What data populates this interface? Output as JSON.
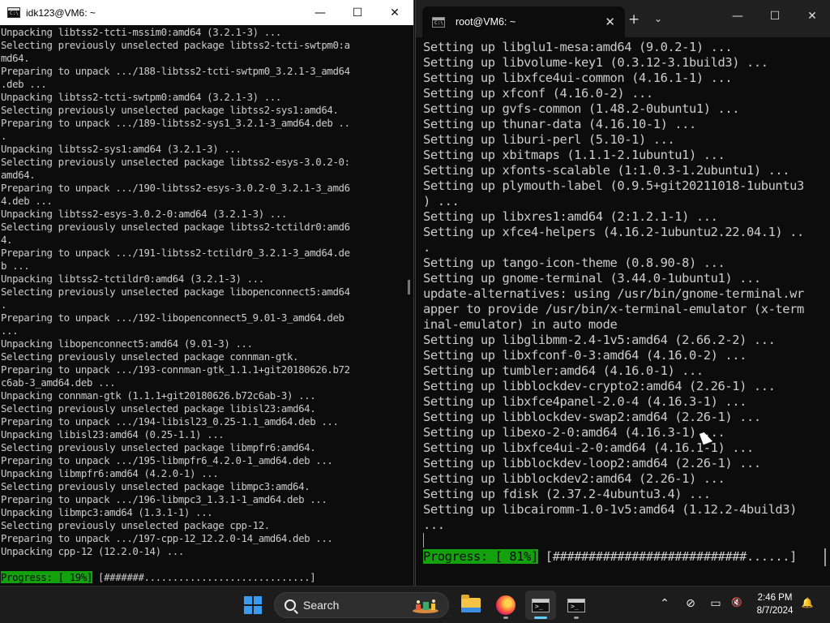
{
  "left_window": {
    "title": "idk123@VM6: ~",
    "app_icon_glyph": "C:\\",
    "controls": {
      "minimize": "—",
      "maximize": "☐",
      "close": "✕"
    },
    "lines": [
      "Unpacking libtss2-tcti-mssim0:amd64 (3.2.1-3) ...",
      "Selecting previously unselected package libtss2-tcti-swtpm0:a",
      "md64.",
      "Preparing to unpack .../188-libtss2-tcti-swtpm0_3.2.1-3_amd64",
      ".deb ...",
      "Unpacking libtss2-tcti-swtpm0:amd64 (3.2.1-3) ...",
      "Selecting previously unselected package libtss2-sys1:amd64.",
      "Preparing to unpack .../189-libtss2-sys1_3.2.1-3_amd64.deb ..",
      ".",
      "Unpacking libtss2-sys1:amd64 (3.2.1-3) ...",
      "Selecting previously unselected package libtss2-esys-3.0.2-0:",
      "amd64.",
      "Preparing to unpack .../190-libtss2-esys-3.0.2-0_3.2.1-3_amd6",
      "4.deb ...",
      "Unpacking libtss2-esys-3.0.2-0:amd64 (3.2.1-3) ...",
      "Selecting previously unselected package libtss2-tctildr0:amd6",
      "4.",
      "Preparing to unpack .../191-libtss2-tctildr0_3.2.1-3_amd64.de",
      "b ...",
      "Unpacking libtss2-tctildr0:amd64 (3.2.1-3) ...",
      "Selecting previously unselected package libopenconnect5:amd64",
      ".",
      "Preparing to unpack .../192-libopenconnect5_9.01-3_amd64.deb",
      "...",
      "Unpacking libopenconnect5:amd64 (9.01-3) ...",
      "Selecting previously unselected package connman-gtk.",
      "Preparing to unpack .../193-connman-gtk_1.1.1+git20180626.b72",
      "c6ab-3_amd64.deb ...",
      "Unpacking connman-gtk (1.1.1+git20180626.b72c6ab-3) ...",
      "Selecting previously unselected package libisl23:amd64.",
      "Preparing to unpack .../194-libisl23_0.25-1.1_amd64.deb ...",
      "Unpacking libisl23:amd64 (0.25-1.1) ...",
      "Selecting previously unselected package libmpfr6:amd64.",
      "Preparing to unpack .../195-libmpfr6_4.2.0-1_amd64.deb ...",
      "Unpacking libmpfr6:amd64 (4.2.0-1) ...",
      "Selecting previously unselected package libmpc3:amd64.",
      "Preparing to unpack .../196-libmpc3_1.3.1-1_amd64.deb ...",
      "Unpacking libmpc3:amd64 (1.3.1-1) ...",
      "Selecting previously unselected package cpp-12.",
      "Preparing to unpack .../197-cpp-12_12.2.0-14_amd64.deb ...",
      "Unpacking cpp-12 (12.2.0-14) ..."
    ],
    "progress_label": "Progress: [ 19%]",
    "progress_bar": " [#######.............................]",
    "progress_percent": 19
  },
  "right_window": {
    "tab_title": "root@VM6: ~",
    "tab_icon_glyph": "C:\\",
    "tab_close": "✕",
    "new_tab": "+",
    "dropdown": "⌄",
    "controls": {
      "minimize": "—",
      "maximize": "☐",
      "close": "✕"
    },
    "lines": [
      "Setting up libglu1-mesa:amd64 (9.0.2-1) ...",
      "Setting up libvolume-key1 (0.3.12-3.1build3) ...",
      "Setting up libxfce4ui-common (4.16.1-1) ...",
      "Setting up xfconf (4.16.0-2) ...",
      "Setting up gvfs-common (1.48.2-0ubuntu1) ...",
      "Setting up thunar-data (4.16.10-1) ...",
      "Setting up liburi-perl (5.10-1) ...",
      "Setting up xbitmaps (1.1.1-2.1ubuntu1) ...",
      "Setting up xfonts-scalable (1:1.0.3-1.2ubuntu1) ...",
      "Setting up plymouth-label (0.9.5+git20211018-1ubuntu3",
      ") ...",
      "Setting up libxres1:amd64 (2:1.2.1-1) ...",
      "Setting up xfce4-helpers (4.16.2-1ubuntu2.22.04.1) ..",
      ".",
      "Setting up tango-icon-theme (0.8.90-8) ...",
      "Setting up gnome-terminal (3.44.0-1ubuntu1) ...",
      "update-alternatives: using /usr/bin/gnome-terminal.wr",
      "apper to provide /usr/bin/x-terminal-emulator (x-term",
      "inal-emulator) in auto mode",
      "Setting up libglibmm-2.4-1v5:amd64 (2.66.2-2) ...",
      "Setting up libxfconf-0-3:amd64 (4.16.0-2) ...",
      "Setting up tumbler:amd64 (4.16.0-1) ...",
      "Setting up libblockdev-crypto2:amd64 (2.26-1) ...",
      "Setting up libxfce4panel-2.0-4 (4.16.3-1) ...",
      "Setting up libblockdev-swap2:amd64 (2.26-1) ...",
      "Setting up libexo-2-0:amd64 (4.16.3-1) ...",
      "Setting up libxfce4ui-2-0:amd64 (4.16.1-1) ...",
      "Setting up libblockdev-loop2:amd64 (2.26-1) ...",
      "Setting up libblockdev2:amd64 (2.26-1) ...",
      "Setting up fdisk (2.37.2-4ubuntu3.4) ...",
      "Setting up libcairomm-1.0-1v5:amd64 (1.12.2-4build3)",
      "..."
    ],
    "progress_label": "Progress: [ 81%]",
    "progress_bar": " [###########################......]",
    "progress_percent": 81
  },
  "taskbar": {
    "search_label": "Search",
    "tray": {
      "chevron": "⌃",
      "network": "⊘",
      "display": "▭",
      "mute": "🔇",
      "bell": "🔔"
    },
    "clock_time": "2:46 PM",
    "clock_date": "8/7/2024",
    "icons": {
      "start": "windows-logo-icon",
      "search": "search-icon",
      "explorer": "folder-icon",
      "firefox": "firefox-icon",
      "terminal1": "terminal-icon",
      "terminal2": "terminal-icon"
    },
    "accent_color": "#60cdff"
  },
  "colors": {
    "terminal_bg": "#0c0c0c",
    "terminal_fg": "#cccccc",
    "progress_green": "#13a10e"
  }
}
